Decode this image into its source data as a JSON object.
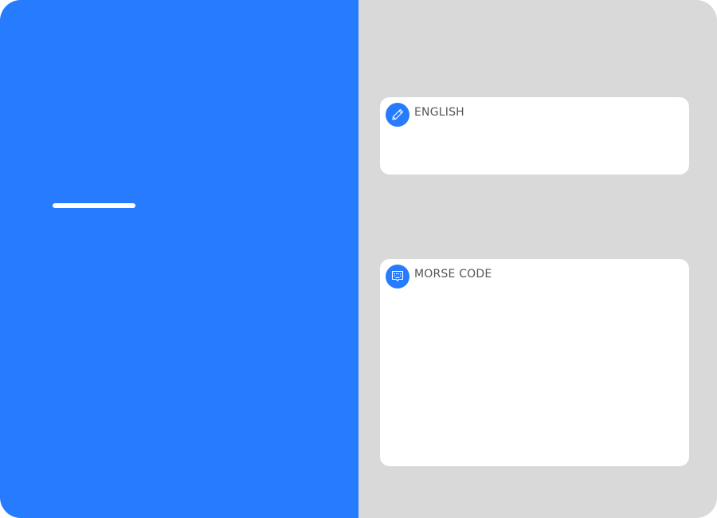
{
  "colors": {
    "accent": "#267bff",
    "panel_background": "#d9d9d9",
    "card_background": "#ffffff",
    "title_text": "#555555"
  },
  "english_card": {
    "title": "English",
    "icon": "pencil-icon",
    "value": ""
  },
  "morse_card": {
    "title": "Morse Code",
    "icon": "chat-keyboard-icon",
    "value": ""
  }
}
